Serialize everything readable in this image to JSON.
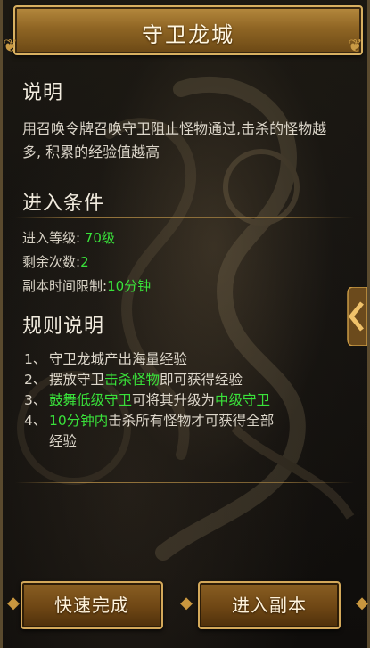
{
  "title": "守卫龙城",
  "sections": {
    "description": {
      "heading": "说明",
      "text": "用召唤令牌召唤守卫阻止怪物通过,击杀的怪物越多, 积累的经验值越高"
    },
    "conditions": {
      "heading": "进入条件",
      "level_label": "进入等级:",
      "level_value": "70级",
      "remaining_label": "剩余次数:",
      "remaining_value": "2",
      "time_label": "副本时间限制:",
      "time_value": "10分钟"
    },
    "rules": {
      "heading": "规则说明",
      "items": [
        {
          "num": "1、",
          "parts": [
            {
              "t": "守卫龙城产出海量经验",
              "g": false
            }
          ]
        },
        {
          "num": "2、",
          "parts": [
            {
              "t": "摆放守卫",
              "g": false
            },
            {
              "t": "击杀怪物",
              "g": true
            },
            {
              "t": "即可获得经验",
              "g": false
            }
          ]
        },
        {
          "num": "3、",
          "parts": [
            {
              "t": "鼓舞低级守卫",
              "g": true
            },
            {
              "t": "可将其升级为",
              "g": false
            },
            {
              "t": "中级守卫",
              "g": true
            }
          ]
        },
        {
          "num": "4、",
          "parts": [
            {
              "t": "10分钟内",
              "g": true
            },
            {
              "t": "击杀所有怪物才可获得全部",
              "g": false
            }
          ]
        },
        {
          "num": "",
          "parts": [
            {
              "t": "经验",
              "g": false
            }
          ]
        }
      ]
    }
  },
  "buttons": {
    "quick_complete": "快速完成",
    "enter_instance": "进入副本"
  },
  "colors": {
    "highlight": "#39e13a",
    "gold_accent": "#d8b061"
  },
  "icons": {
    "side_tab": "chevron-left-icon"
  }
}
